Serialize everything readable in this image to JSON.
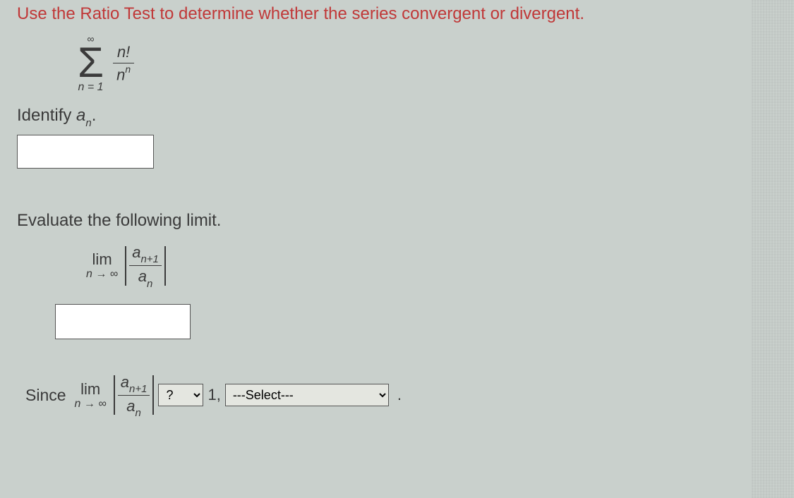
{
  "instruction": "Use the Ratio Test to determine whether the series convergent or divergent.",
  "sum": {
    "upper": "∞",
    "lower": "n = 1",
    "numerator": "n!",
    "denom_base": "n",
    "denom_exp": "n"
  },
  "identify_label_pre": "Identify ",
  "identify_var": "a",
  "identify_sub": "n",
  "identify_label_post": ".",
  "input1_value": "",
  "evaluate_label": "Evaluate the following limit.",
  "lim": {
    "top": "lim",
    "bot_pre": "n → ∞",
    "ratio_num_a": "a",
    "ratio_num_sub": "n+1",
    "ratio_den_a": "a",
    "ratio_den_sub": "n"
  },
  "input2_value": "",
  "since_label": "Since",
  "cmp_placeholder": "?",
  "one_label": "1,",
  "conclusion_placeholder": "---Select---",
  "period": "."
}
